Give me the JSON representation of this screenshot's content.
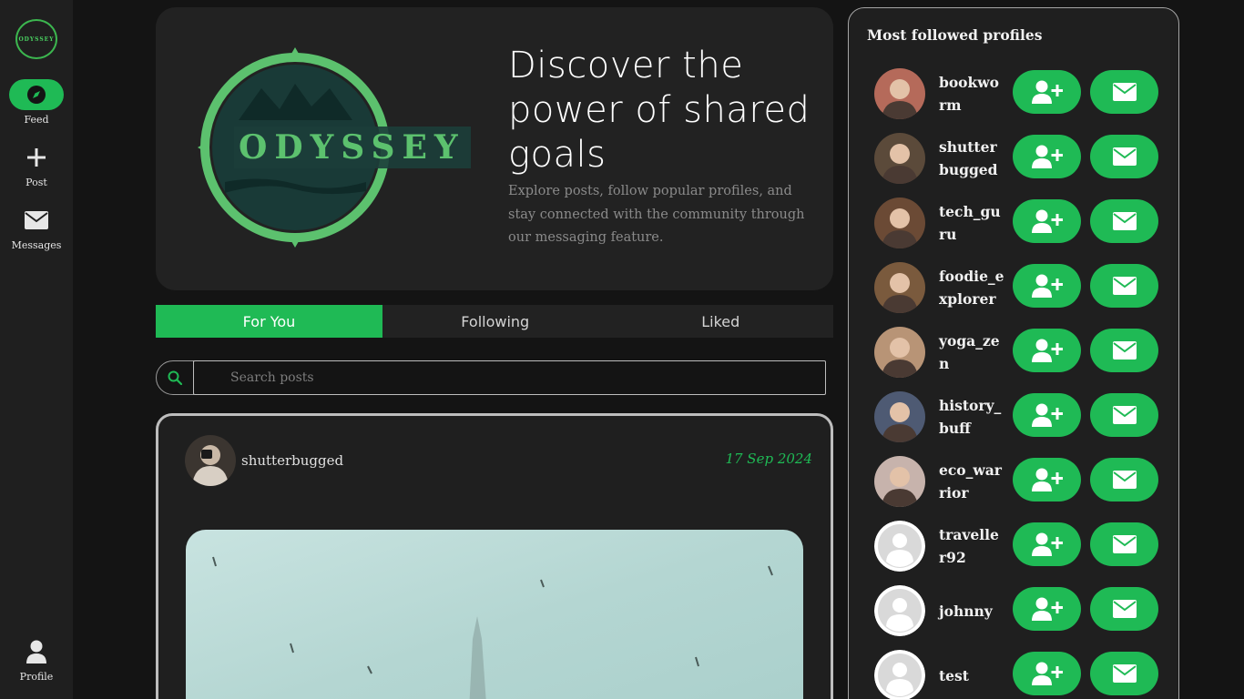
{
  "app": {
    "logo_text": "ODYSSEY",
    "accent_color": "#1fba55"
  },
  "sidebar": {
    "items": [
      {
        "label": "Feed",
        "icon": "compass-icon",
        "active": true
      },
      {
        "label": "Post",
        "icon": "plus-icon"
      },
      {
        "label": "Messages",
        "icon": "envelope-icon"
      }
    ],
    "profile": {
      "label": "Profile",
      "icon": "user-icon"
    }
  },
  "hero": {
    "logo_text": "ODYSSEY",
    "title": "Discover the power of shared goals",
    "description": "Explore posts, follow popular profiles, and stay connected with the community through our messaging feature."
  },
  "tabs": [
    {
      "label": "For You",
      "active": true
    },
    {
      "label": "Following"
    },
    {
      "label": "Liked"
    }
  ],
  "search": {
    "placeholder": "Search posts",
    "icon": "search-icon"
  },
  "post": {
    "username": "shutterbugged",
    "date": "17 Sep 2024"
  },
  "sidebar_right": {
    "title": "Most followed profiles",
    "profiles": [
      {
        "name": "bookworm",
        "avatar_color": "#b56a5a"
      },
      {
        "name": "shutterbugged",
        "avatar_color": "#5b4a3a"
      },
      {
        "name": "tech_guru",
        "avatar_color": "#6b4a35"
      },
      {
        "name": "foodie_explorer",
        "avatar_color": "#7a5a3d"
      },
      {
        "name": "yoga_zen",
        "avatar_color": "#b89476"
      },
      {
        "name": "history_buff",
        "avatar_color": "#4e5a73"
      },
      {
        "name": "eco_warrior",
        "avatar_color": "#c7b3ac"
      },
      {
        "name": "traveller92",
        "avatar_color": "default"
      },
      {
        "name": "johnny",
        "avatar_color": "default"
      },
      {
        "name": "test",
        "avatar_color": "default"
      }
    ]
  }
}
